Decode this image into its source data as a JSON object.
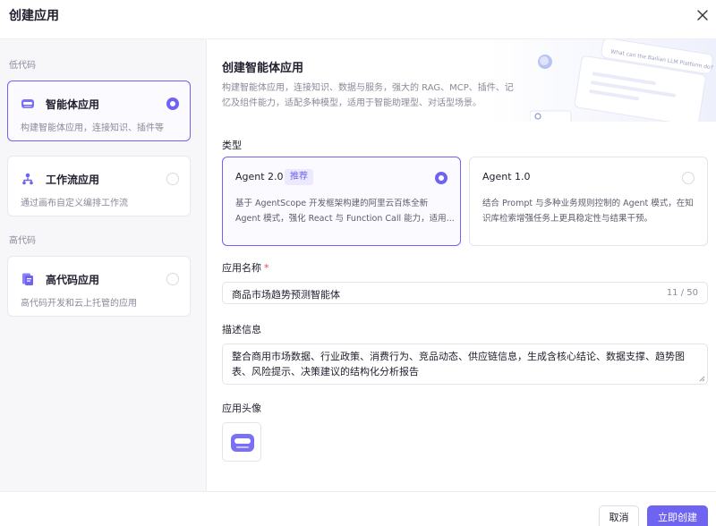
{
  "dialog": {
    "title": "创建应用"
  },
  "sidebar": {
    "group_low_code": "低代码",
    "group_high_code": "高代码",
    "items": [
      {
        "title": "智能体应用",
        "desc": "构建智能体应用，连接知识、插件等",
        "selected": true
      },
      {
        "title": "工作流应用",
        "desc": "通过画布自定义编排工作流",
        "selected": false
      },
      {
        "title": "高代码应用",
        "desc": "高代码开发和云上托管的应用",
        "selected": false
      }
    ]
  },
  "main": {
    "title": "创建智能体应用",
    "desc": "构建智能体应用，连接知识、数据与服务，强大的 RAG、MCP、插件、记忆及组件能力，适配多种模型，适用于智能助理型、对话型场景。",
    "banner_bubble_text": "What can the Bailian LLM Platform do?",
    "type_label": "类型",
    "types": [
      {
        "name": "Agent 2.0",
        "badge": "推荐",
        "desc": "基于 AgentScope 开发框架构建的阿里云百炼全新 Agent 模式，强化 React 与 Function Call 能力，适用...",
        "selected": true
      },
      {
        "name": "Agent 1.0",
        "badge": "",
        "desc": "结合 Prompt 与多种业务规则控制的 Agent 模式，在知识库检索增强任务上更具稳定性与结果干预。",
        "selected": false
      }
    ],
    "name_label": "应用名称",
    "name_required": "*",
    "name_value": "商品市场趋势预测智能体",
    "name_counter": "11 / 50",
    "desc_label": "描述信息",
    "desc_value": "整合商用市场数据、行业政策、消费行为、竞品动态、供应链信息，生成含核心结论、数据支撑、趋势图表、风险提示、决策建议的结构化分析报告",
    "avatar_label": "应用头像"
  },
  "footer": {
    "cancel": "取消",
    "create": "立即创建"
  },
  "colors": {
    "accent": "#6f63f2",
    "badge_bg": "#ece9fe",
    "required": "#e5484d"
  }
}
